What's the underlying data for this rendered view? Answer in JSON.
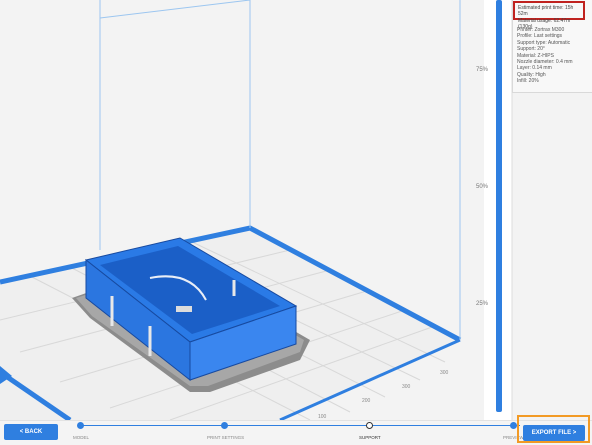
{
  "info": {
    "estimated_print_time": "Estimated print time: 15h 52m",
    "material_usage": "Material usage: 62.47m (130g)",
    "printer": "Printer: Zortrax M300",
    "profile": "Profile: Last settings",
    "support_type": "Support type: Automatic",
    "support": "Support: 20°",
    "material": "Material: Z-HIPS",
    "nozzle": "Nozzle diameter: 0.4 mm",
    "layer": "Layer: 0.14 mm",
    "quality": "Quality: High",
    "infill": "Infill: 20%"
  },
  "slider": {
    "ticks": [
      "75%",
      "50%",
      "25%"
    ],
    "level": 1.0
  },
  "grid_labels": [
    "300",
    "200",
    "100"
  ],
  "steps": [
    "MODEL",
    "PRINT SETTINGS",
    "SUPPORT",
    "PREVIEW"
  ],
  "current_step": "SUPPORT",
  "buttons": {
    "back": "< BACK",
    "export": "EXPORT FILE >"
  },
  "colors": {
    "accent": "#2f7fe0",
    "model": "#1f6fe0",
    "estimate_highlight": "#c0221f",
    "export_highlight": "#f29a25"
  }
}
